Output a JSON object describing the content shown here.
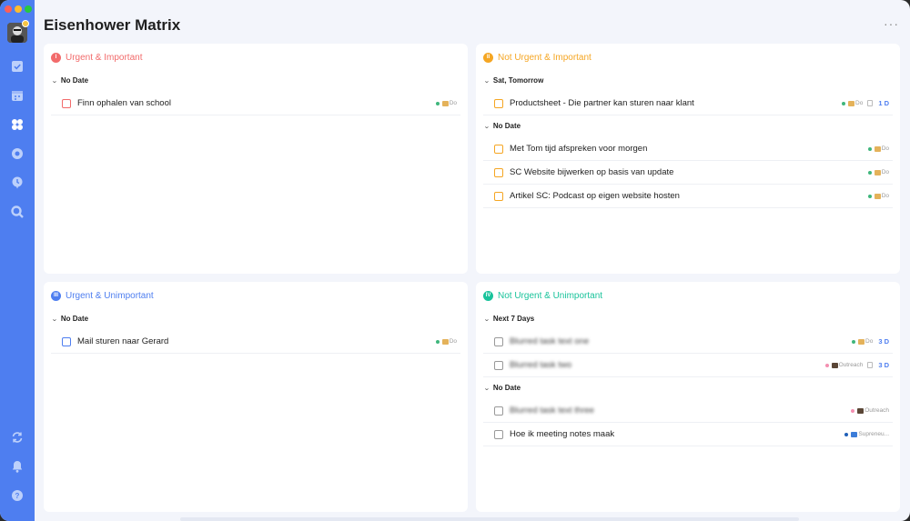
{
  "window": {
    "title": "Eisenhower Matrix",
    "more_label": "···"
  },
  "colors": {
    "sidebar": "#4e7ef0",
    "q1": "#f26b6b",
    "q2": "#f5a623",
    "q3": "#4e7ef0",
    "q4": "#19c39b",
    "due": "#4e7ef0"
  },
  "sidebar": {
    "icons": [
      "checkbox-icon",
      "calendar-icon",
      "matrix-icon",
      "focus-icon",
      "clock-icon",
      "search-icon",
      "sync-icon",
      "bell-icon",
      "help-icon"
    ]
  },
  "quadrants": {
    "q1": {
      "badge": "I",
      "title": "Urgent & Important",
      "groups": [
        {
          "label": "No Date",
          "tasks": [
            {
              "text": "Finn ophalen van school",
              "list": "Do",
              "due": ""
            }
          ]
        }
      ]
    },
    "q2": {
      "badge": "II",
      "title": "Not Urgent & Important",
      "groups": [
        {
          "label": "Sat, Tomorrow",
          "tasks": [
            {
              "text": "Productsheet - Die partner kan sturen naar klant",
              "list": "Do",
              "due": "1 D"
            }
          ]
        },
        {
          "label": "No Date",
          "tasks": [
            {
              "text": "Met Tom tijd afspreken voor morgen",
              "list": "Do",
              "due": ""
            },
            {
              "text": "SC Website bijwerken op basis van update",
              "list": "Do",
              "due": ""
            },
            {
              "text": "Artikel SC: Podcast op eigen website hosten",
              "list": "Do",
              "due": ""
            }
          ]
        }
      ]
    },
    "q3": {
      "badge": "III",
      "title": "Urgent & Unimportant",
      "groups": [
        {
          "label": "No Date",
          "tasks": [
            {
              "text": "Mail sturen naar Gerard",
              "list": "Do",
              "due": ""
            }
          ]
        }
      ]
    },
    "q4": {
      "badge": "IV",
      "title": "Not Urgent & Unimportant",
      "groups": [
        {
          "label": "Next 7 Days",
          "tasks": [
            {
              "text": "Blurred task text one",
              "list": "Do",
              "due": "3 D"
            },
            {
              "text": "Blurred task two",
              "list": "Outreach",
              "due": "3 D"
            }
          ]
        },
        {
          "label": "No Date",
          "tasks": [
            {
              "text": "Blurred task text three",
              "list": "Outreach",
              "due": ""
            },
            {
              "text": "Hoe ik meeting notes maak",
              "list": "Supreneu...",
              "due": ""
            }
          ]
        }
      ]
    }
  }
}
